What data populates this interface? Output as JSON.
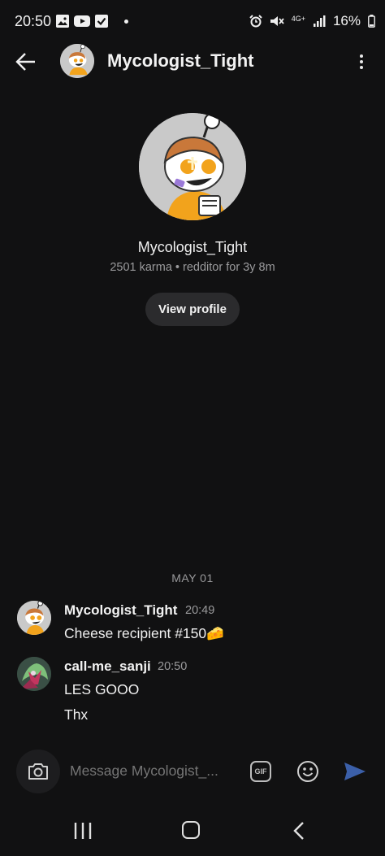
{
  "status_bar": {
    "time": "20:50",
    "network": "4G+",
    "battery": "16%"
  },
  "header": {
    "title": "Mycologist_Tight"
  },
  "profile": {
    "name": "Mycologist_Tight",
    "meta": "2501 karma • redditor for 3y 8m",
    "view_profile_label": "View profile"
  },
  "chat": {
    "date_separator": "MAY 01",
    "messages": [
      {
        "author": "Mycologist_Tight",
        "time": "20:49",
        "lines": [
          "Cheese recipient #150🧀"
        ]
      },
      {
        "author": "call-me_sanji",
        "time": "20:50",
        "lines": [
          "LES GOOO",
          "Thx"
        ]
      }
    ]
  },
  "composer": {
    "placeholder": "Message Mycologist_...",
    "gif_label": "GIF"
  },
  "colors": {
    "background": "#111112",
    "send_accent": "#3b5fa8",
    "avatar_orange": "#f2a31c"
  }
}
